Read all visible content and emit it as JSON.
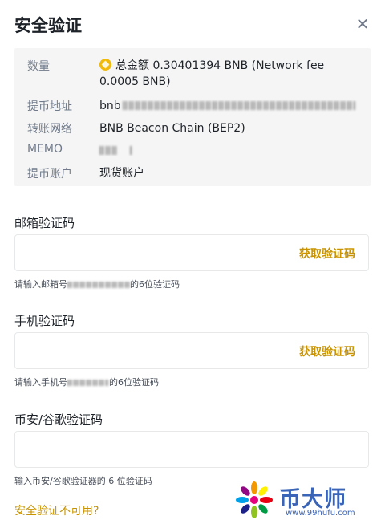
{
  "dialog": {
    "title": "安全验证",
    "close_icon": "close-icon"
  },
  "summary": {
    "amount": {
      "label": "数量",
      "value": "总金额 0.30401394 BNB (Network fee 0.0005 BNB)",
      "coin_icon": "bnb-coin-icon"
    },
    "address": {
      "label": "提币地址",
      "prefix": "bnb"
    },
    "network": {
      "label": "转账网络",
      "value": "BNB Beacon Chain (BEP2)"
    },
    "memo": {
      "label": "MEMO"
    },
    "account": {
      "label": "提币账户",
      "value": "现货账户"
    }
  },
  "email_code": {
    "label": "邮箱验证码",
    "get_code": "获取验证码",
    "hint_prefix": "请输入邮箱号",
    "hint_suffix": "的6位验证码",
    "value": ""
  },
  "phone_code": {
    "label": "手机验证码",
    "get_code": "获取验证码",
    "hint_prefix": "请输入手机号",
    "hint_suffix": "的6位验证码",
    "value": ""
  },
  "authenticator": {
    "label": "币安/谷歌验证码",
    "hint": "输入币安/谷歌验证器的 6 位验证码",
    "value": ""
  },
  "footer": {
    "unavailable_link": "安全验证不可用?"
  },
  "watermark": {
    "name": "币大师",
    "url": "www.99hufu.com"
  },
  "colors": {
    "accent": "#c99400",
    "brand_yellow": "#f0b90b",
    "panel_bg": "#f5f5f5",
    "watermark_blue": "#3a64b8"
  }
}
